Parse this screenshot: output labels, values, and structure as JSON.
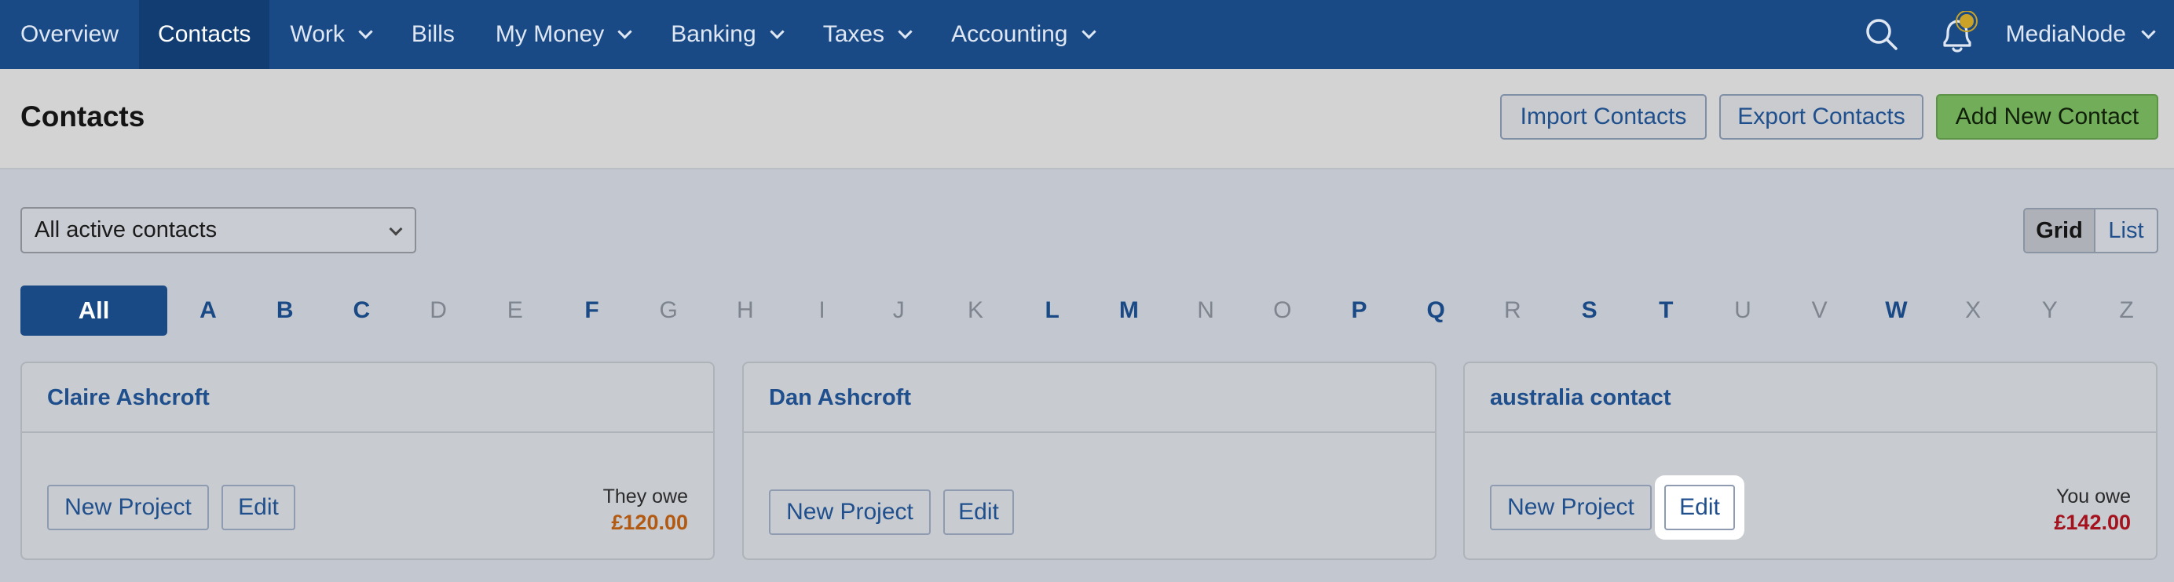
{
  "nav": {
    "items": [
      {
        "label": "Overview",
        "has_dropdown": false,
        "active": false
      },
      {
        "label": "Contacts",
        "has_dropdown": false,
        "active": true
      },
      {
        "label": "Work",
        "has_dropdown": true,
        "active": false
      },
      {
        "label": "Bills",
        "has_dropdown": false,
        "active": false
      },
      {
        "label": "My Money",
        "has_dropdown": true,
        "active": false
      },
      {
        "label": "Banking",
        "has_dropdown": true,
        "active": false
      },
      {
        "label": "Taxes",
        "has_dropdown": true,
        "active": false
      },
      {
        "label": "Accounting",
        "has_dropdown": true,
        "active": false
      }
    ],
    "search_icon": "search-icon",
    "notification_icon": "bell-icon",
    "account_name": "MediaNode"
  },
  "header": {
    "title": "Contacts",
    "import_label": "Import Contacts",
    "export_label": "Export Contacts",
    "add_label": "Add New Contact"
  },
  "filter": {
    "selected": "All active contacts"
  },
  "view_toggle": {
    "grid_label": "Grid",
    "list_label": "List",
    "active": "Grid"
  },
  "alphabet": {
    "all_label": "All",
    "letters": [
      {
        "letter": "A",
        "enabled": true
      },
      {
        "letter": "B",
        "enabled": true
      },
      {
        "letter": "C",
        "enabled": true
      },
      {
        "letter": "D",
        "enabled": false
      },
      {
        "letter": "E",
        "enabled": false
      },
      {
        "letter": "F",
        "enabled": true
      },
      {
        "letter": "G",
        "enabled": false
      },
      {
        "letter": "H",
        "enabled": false
      },
      {
        "letter": "I",
        "enabled": false
      },
      {
        "letter": "J",
        "enabled": false
      },
      {
        "letter": "K",
        "enabled": false
      },
      {
        "letter": "L",
        "enabled": true
      },
      {
        "letter": "M",
        "enabled": true
      },
      {
        "letter": "N",
        "enabled": false
      },
      {
        "letter": "O",
        "enabled": false
      },
      {
        "letter": "P",
        "enabled": true
      },
      {
        "letter": "Q",
        "enabled": true
      },
      {
        "letter": "R",
        "enabled": false
      },
      {
        "letter": "S",
        "enabled": true
      },
      {
        "letter": "T",
        "enabled": true
      },
      {
        "letter": "U",
        "enabled": false
      },
      {
        "letter": "V",
        "enabled": false
      },
      {
        "letter": "W",
        "enabled": true
      },
      {
        "letter": "X",
        "enabled": false
      },
      {
        "letter": "Y",
        "enabled": false
      },
      {
        "letter": "Z",
        "enabled": false
      }
    ]
  },
  "contacts": [
    {
      "name": "Claire Ashcroft",
      "new_project_label": "New Project",
      "edit_label": "Edit",
      "balance_label": "They owe",
      "balance_amount": "£120.00",
      "balance_color": "#b35a12"
    },
    {
      "name": "Dan Ashcroft",
      "new_project_label": "New Project",
      "edit_label": "Edit",
      "balance_label": "",
      "balance_amount": "",
      "balance_color": ""
    },
    {
      "name": "australia contact",
      "new_project_label": "New Project",
      "edit_label": "Edit",
      "balance_label": "You owe",
      "balance_amount": "£142.00",
      "balance_color": "#a3121d"
    }
  ],
  "colors": {
    "nav_bg": "#1a4a86",
    "link": "#1f4f8c",
    "primary_green": "#72ad5a"
  }
}
